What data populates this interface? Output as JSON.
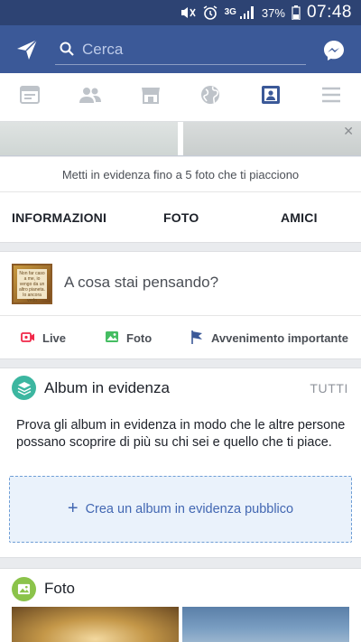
{
  "status_bar": {
    "network": "3G",
    "battery": "37%",
    "time": "07:48",
    "icons": [
      "mute-icon",
      "alarm-icon",
      "signal-icon",
      "battery-icon"
    ]
  },
  "app_bar": {
    "search_placeholder": "Cerca",
    "left_icon": "paper-plane-icon",
    "right_icon": "messenger-icon",
    "colors": {
      "brand": "#3b5998",
      "status": "#2d4373"
    }
  },
  "nav_tabs": [
    {
      "icon": "news-feed-icon",
      "active": false
    },
    {
      "icon": "friend-requests-icon",
      "active": false
    },
    {
      "icon": "marketplace-icon",
      "active": false
    },
    {
      "icon": "globe-icon",
      "active": false
    },
    {
      "icon": "profile-icon",
      "active": true
    },
    {
      "icon": "menu-icon",
      "active": false
    }
  ],
  "cover": {
    "close_glyph": "✕"
  },
  "featured_hint": "Metti in evidenza fino a 5 foto che ti piacciono",
  "profile_tabs": [
    "INFORMAZIONI",
    "FOTO",
    "AMICI"
  ],
  "composer": {
    "prompt": "A cosa stai pensando?",
    "avatar_text": "Non far caso a me, io vengo da un altro pianeta. Io ancora vedo orizzonti dove tu disegni confini"
  },
  "actions": [
    {
      "label": "Live",
      "icon": "live-video-icon",
      "color": "#f02849"
    },
    {
      "label": "Foto",
      "icon": "photo-icon",
      "color": "#45bd62"
    },
    {
      "label": "Avvenimento importante",
      "icon": "flag-icon",
      "color": "#1877f2"
    }
  ],
  "featured_albums": {
    "title": "Album in evidenza",
    "see_all": "TUTTI",
    "description": "Prova gli album in evidenza in modo che le altre persone possano scoprire di più su chi sei e quello che ti piace.",
    "create_label": "Crea un album in evidenza pubblico",
    "icon_color": "#3cb6a0"
  },
  "photos": {
    "title": "Foto",
    "icon_color": "#8bc34a"
  }
}
